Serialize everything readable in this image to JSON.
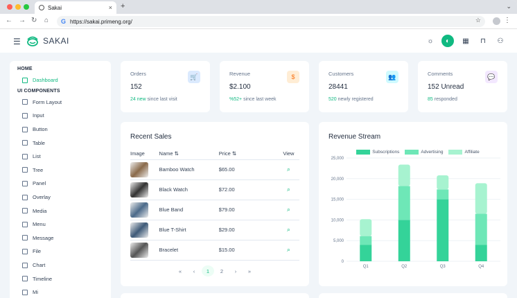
{
  "browser": {
    "tab_title": "Sakai",
    "url": "https://sakai.primeng.org/",
    "new_tab": "+",
    "close": "×"
  },
  "app": {
    "brand": "SAKAI"
  },
  "sidebar": {
    "home_label": "HOME",
    "home_items": [
      {
        "label": "Dashboard",
        "icon": "home-icon"
      }
    ],
    "ui_label": "UI COMPONENTS",
    "ui_items": [
      {
        "label": "Form Layout",
        "icon": "id-card-icon"
      },
      {
        "label": "Input",
        "icon": "check-square-icon"
      },
      {
        "label": "Button",
        "icon": "mobile-icon"
      },
      {
        "label": "Table",
        "icon": "table-icon"
      },
      {
        "label": "List",
        "icon": "list-icon"
      },
      {
        "label": "Tree",
        "icon": "share-icon"
      },
      {
        "label": "Panel",
        "icon": "tablet-icon"
      },
      {
        "label": "Overlay",
        "icon": "clone-icon"
      },
      {
        "label": "Media",
        "icon": "image-icon"
      },
      {
        "label": "Menu",
        "icon": "bars-icon"
      },
      {
        "label": "Message",
        "icon": "comment-icon"
      },
      {
        "label": "File",
        "icon": "file-icon"
      },
      {
        "label": "Chart",
        "icon": "chart-bar-icon"
      },
      {
        "label": "Timeline",
        "icon": "calendar-icon"
      },
      {
        "label": "Mi",
        "icon": "circle-icon"
      }
    ]
  },
  "stats": [
    {
      "label": "Orders",
      "value": "152",
      "highlight": "24 new",
      "rest": "since last visit",
      "badge_color": "#dbeafe",
      "icon_color": "#3b82f6",
      "icon": "shopping-cart-icon",
      "glyph": "🛒"
    },
    {
      "label": "Revenue",
      "value": "$2.100",
      "highlight": "%52+",
      "rest": "since last week",
      "badge_color": "#ffedd5",
      "icon_color": "#f97316",
      "icon": "dollar-icon",
      "glyph": "$"
    },
    {
      "label": "Customers",
      "value": "28441",
      "highlight": "520",
      "rest": "newly registered",
      "badge_color": "#cffafe",
      "icon_color": "#06b6d4",
      "icon": "users-icon",
      "glyph": "👥"
    },
    {
      "label": "Comments",
      "value": "152 Unread",
      "highlight": "85",
      "rest": "responded",
      "badge_color": "#f3e8ff",
      "icon_color": "#a855f7",
      "icon": "comment-icon",
      "glyph": "💬"
    }
  ],
  "recent_sales": {
    "title": "Recent Sales",
    "columns": {
      "image": "Image",
      "name": "Name",
      "price": "Price",
      "view": "View"
    },
    "rows": [
      {
        "name": "Bamboo Watch",
        "price": "$65.00",
        "thumb": "#8a6a4a"
      },
      {
        "name": "Black Watch",
        "price": "$72.00",
        "thumb": "#333333"
      },
      {
        "name": "Blue Band",
        "price": "$79.00",
        "thumb": "#4b6a8a"
      },
      {
        "name": "Blue T-Shirt",
        "price": "$29.00",
        "thumb": "#3e5a78"
      },
      {
        "name": "Bracelet",
        "price": "$15.00",
        "thumb": "#555555"
      }
    ],
    "pager": [
      "«",
      "‹",
      "1",
      "2",
      "›",
      "»"
    ]
  },
  "chart_data": {
    "type": "bar",
    "title": "Revenue Stream",
    "stacked": true,
    "categories": [
      "Q1",
      "Q2",
      "Q3",
      "Q4"
    ],
    "series": [
      {
        "name": "Subscriptions",
        "values": [
          4000,
          10000,
          15000,
          4000
        ],
        "color": "#34d399"
      },
      {
        "name": "Advertising",
        "values": [
          2100,
          8200,
          2400,
          7500
        ],
        "color": "#6ee7b7"
      },
      {
        "name": "Affiliate",
        "values": [
          4100,
          5200,
          3400,
          7400
        ],
        "color": "#a7f3d0"
      }
    ],
    "yticks": [
      "0",
      "5,000",
      "10,000",
      "15,000",
      "20,000",
      "25,000"
    ],
    "ylim": [
      0,
      25000
    ],
    "grid": true,
    "legend": "top"
  }
}
